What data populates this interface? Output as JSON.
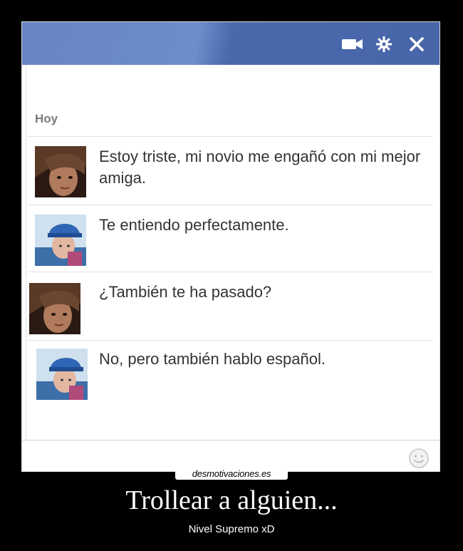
{
  "chat": {
    "header_icons": [
      "video-camera-icon",
      "gear-icon",
      "close-icon"
    ],
    "date_label": "Hoy",
    "messages": [
      {
        "sender": "girl",
        "text": "Estoy triste, mi novio me engañó con mi mejor amiga."
      },
      {
        "sender": "boy",
        "text": "Te entiendo perfectamente."
      },
      {
        "sender": "girl",
        "text": "¿También te ha pasado?"
      },
      {
        "sender": "boy",
        "text": "No, pero también hablo español."
      }
    ],
    "composer_icon": "smiley-icon"
  },
  "poster": {
    "watermark": "desmotivaciones.es",
    "title": "Trollear a alguien...",
    "subtitle": "Nivel Supremo xD"
  },
  "colors": {
    "header_blue": "#4866a9",
    "background": "#000000",
    "chat_background": "#ffffff",
    "text": "#333333"
  }
}
